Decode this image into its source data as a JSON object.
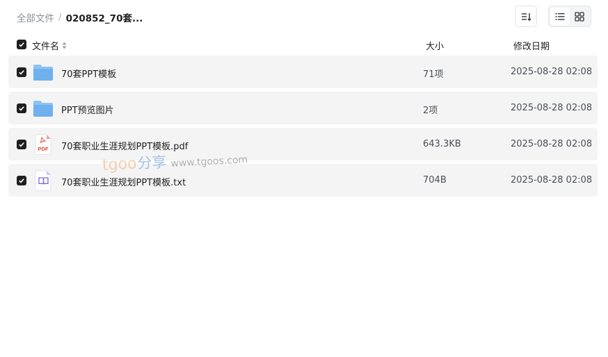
{
  "breadcrumb": {
    "root": "全部文件",
    "separator": "/",
    "current": "020852_70套..."
  },
  "toolbar": {
    "sort_icon": "sort-lines-icon",
    "view_list_icon": "list-view-icon",
    "view_grid_icon": "grid-view-icon",
    "active_view": "list"
  },
  "columns": {
    "name": "文件名",
    "size": "大小",
    "date": "修改日期"
  },
  "files": [
    {
      "name": "70套PPT模板",
      "size": "71项",
      "date": "2025-08-28 02:08",
      "icon": "folder-icon",
      "checked": true
    },
    {
      "name": "PPT预览图片",
      "size": "2项",
      "date": "2025-08-28 02:08",
      "icon": "folder-icon",
      "checked": true
    },
    {
      "name": "70套职业生涯规划PPT模板.pdf",
      "size": "643.3KB",
      "date": "2025-08-28 02:08",
      "icon": "pdf-icon",
      "checked": true,
      "icon_label": "PDF"
    },
    {
      "name": "70套职业生涯规划PPT模板.txt",
      "size": "704B",
      "date": "2025-08-28 02:08",
      "icon": "txt-book-icon",
      "checked": true
    }
  ],
  "watermark": {
    "brand": "tgoo",
    "share": "分享",
    "url": "www.tgoos.com"
  },
  "colors": {
    "folder": "#7fb8f0",
    "pdf": "#e8473b",
    "txt": "#7b6be0",
    "row_bg": "#f4f4f5",
    "checkbox": "#1f1f1f"
  }
}
